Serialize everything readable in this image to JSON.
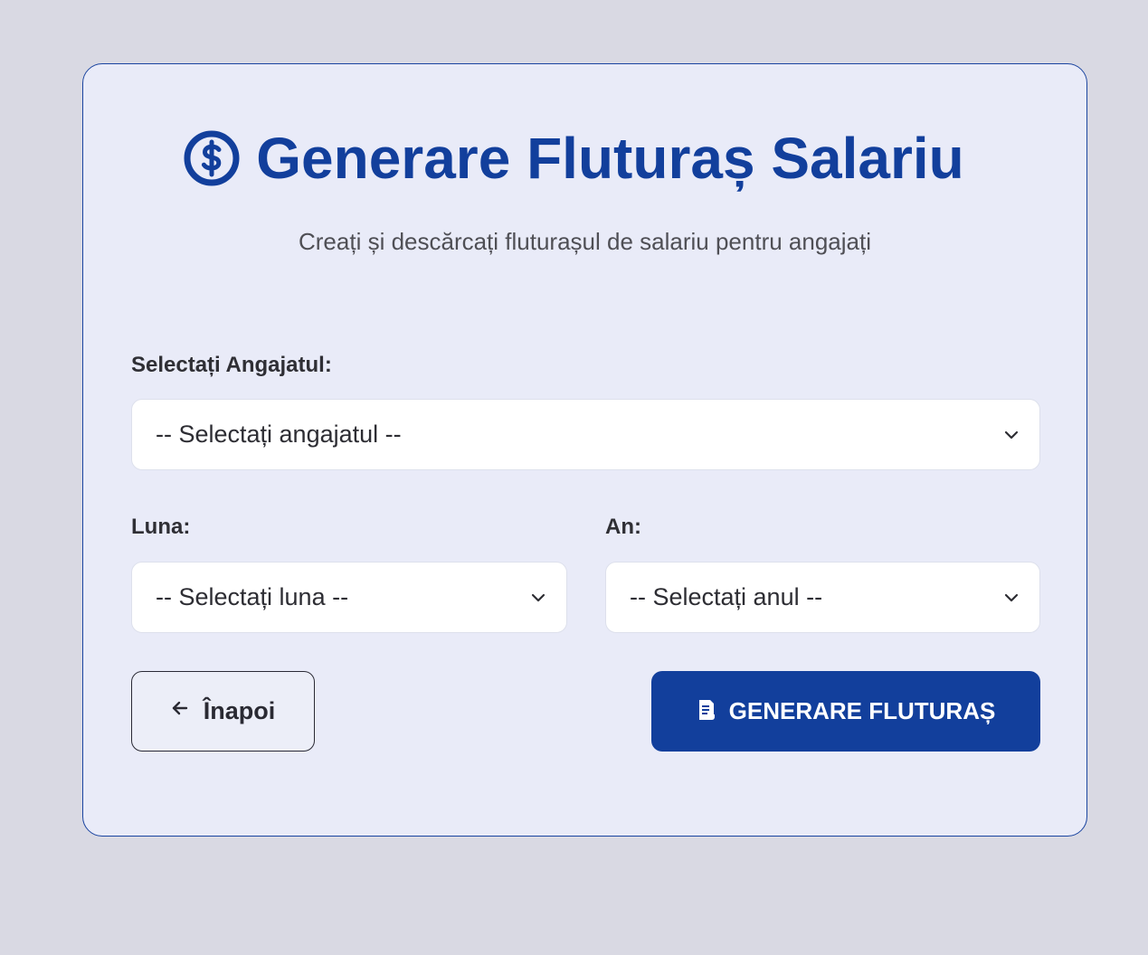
{
  "header": {
    "icon": "dollar-circle-icon",
    "title": "Generare Fluturaș Salariu",
    "subtitle": "Creați și descărcați fluturașul de salariu pentru angajați"
  },
  "form": {
    "employee": {
      "label": "Selectați Angajatul:",
      "value": "-- Selectați angajatul --"
    },
    "month": {
      "label": "Luna:",
      "value": "-- Selectați luna --"
    },
    "year": {
      "label": "An:",
      "value": "-- Selectați anul --"
    }
  },
  "actions": {
    "back_label": "Înapoi",
    "back_icon": "arrow-left-icon",
    "generate_label": "GENERARE FLUTURAȘ",
    "generate_icon": "document-icon"
  },
  "colors": {
    "accent": "#123f9c",
    "card_bg": "#e9ebf8",
    "page_bg": "#d9d9e3"
  }
}
